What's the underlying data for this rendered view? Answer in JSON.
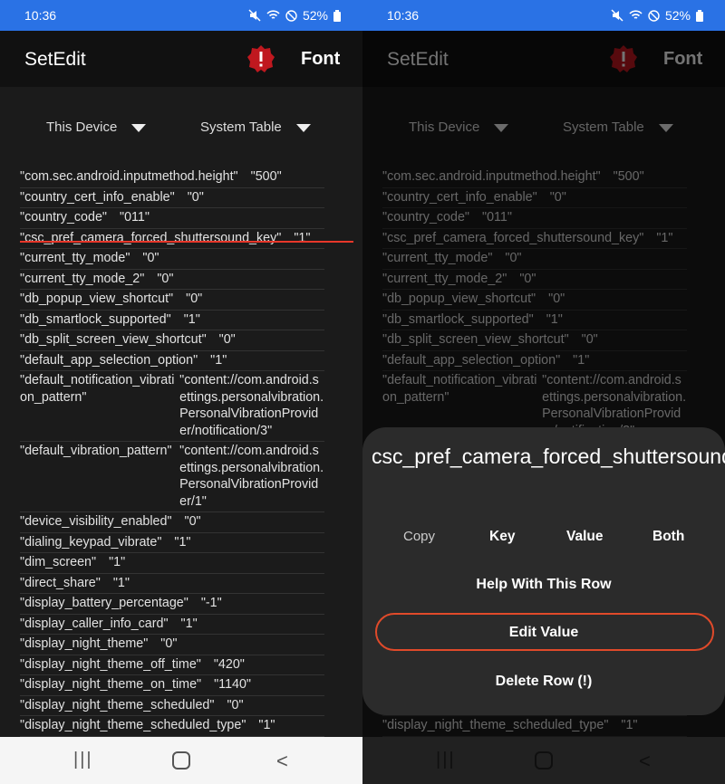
{
  "status": {
    "time": "10:36",
    "battery": "52%"
  },
  "appbar": {
    "title": "SetEdit",
    "font_label": "Font"
  },
  "selectors": {
    "device": "This Device",
    "table": "System Table"
  },
  "rows_left": [
    {
      "k": "\"com.sec.android.inputmethod.height\"",
      "v": "\"500\""
    },
    {
      "k": "\"country_cert_info_enable\"",
      "v": "\"0\""
    },
    {
      "k": "\"country_code\"",
      "v": "\"011\""
    },
    {
      "k": "\"csc_pref_camera_forced_shuttersound_key\"",
      "v": "\"1\""
    },
    {
      "k": "\"current_tty_mode\"",
      "v": "\"0\""
    },
    {
      "k": "\"current_tty_mode_2\"",
      "v": "\"0\""
    },
    {
      "k": "\"db_popup_view_shortcut\"",
      "v": "\"0\""
    },
    {
      "k": "\"db_smartlock_supported\"",
      "v": "\"1\""
    },
    {
      "k": "\"db_split_screen_view_shortcut\"",
      "v": "\"0\""
    },
    {
      "k": "\"default_app_selection_option\"",
      "v": "\"1\""
    },
    {
      "k": "\"default_notification_vibration_pattern\"",
      "v": "\"content://com.android.settings.personalvibration.PersonalVibrationProvider/notification/3\""
    },
    {
      "k": "\"default_vibration_pattern\"",
      "v": "\"content://com.android.settings.personalvibration.PersonalVibrationProvider/1\""
    },
    {
      "k": "\"device_visibility_enabled\"",
      "v": "\"0\""
    },
    {
      "k": "\"dialing_keypad_vibrate\"",
      "v": "\"1\""
    },
    {
      "k": "\"dim_screen\"",
      "v": "\"1\""
    },
    {
      "k": "\"direct_share\"",
      "v": "\"1\""
    },
    {
      "k": "\"display_battery_percentage\"",
      "v": "\"-1\""
    },
    {
      "k": "\"display_caller_info_card\"",
      "v": "\"1\""
    },
    {
      "k": "\"display_night_theme\"",
      "v": "\"0\""
    },
    {
      "k": "\"display_night_theme_off_time\"",
      "v": "\"420\""
    },
    {
      "k": "\"display_night_theme_on_time\"",
      "v": "\"1140\""
    },
    {
      "k": "\"display_night_theme_scheduled\"",
      "v": "\"0\""
    },
    {
      "k": "\"display_night_theme_scheduled_type\"",
      "v": "\"1\""
    }
  ],
  "dialog": {
    "title": "csc_pref_camera_forced_shuttersound_key",
    "copy_label": "Copy",
    "key_label": "Key",
    "value_label": "Value",
    "both_label": "Both",
    "help_label": "Help With This Row",
    "edit_label": "Edit Value",
    "delete_label": "Delete Row (!)"
  },
  "colors": {
    "status_bar": "#2a72e5",
    "highlight": "#e8372a",
    "alert": "#c0181f"
  }
}
